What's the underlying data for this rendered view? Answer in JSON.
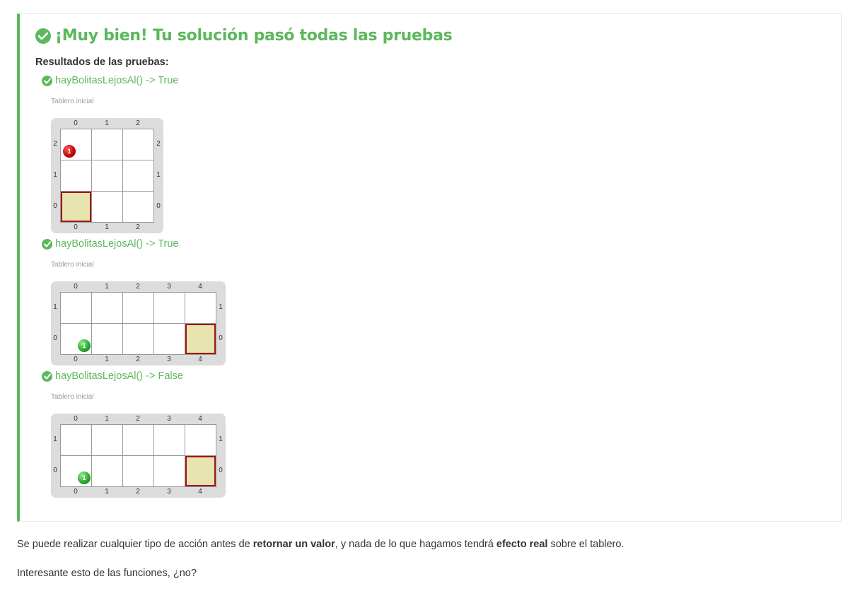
{
  "result": {
    "title": "¡Muy bien! Tu solución pasó todas las pruebas",
    "results_heading": "Resultados de las pruebas:"
  },
  "tests": [
    {
      "label": "hayBolitasLejosAl() -> True",
      "caption": "Tablero inicial",
      "cols": [
        "0",
        "1",
        "2"
      ],
      "rows": [
        "2",
        "1",
        "0"
      ],
      "bolita": {
        "color": "red",
        "count": "1",
        "col": 0,
        "row": 2
      },
      "head": {
        "col": 0,
        "row": 0
      }
    },
    {
      "label": "hayBolitasLejosAl() -> True",
      "caption": "Tablero inicial",
      "cols": [
        "0",
        "1",
        "2",
        "3",
        "4"
      ],
      "rows": [
        "1",
        "0"
      ],
      "bolita": {
        "color": "green",
        "count": "1",
        "col": 0,
        "row": 0
      },
      "head": {
        "col": 4,
        "row": 0
      }
    },
    {
      "label": "hayBolitasLejosAl() -> False",
      "caption": "Tablero inicial",
      "cols": [
        "0",
        "1",
        "2",
        "3",
        "4"
      ],
      "rows": [
        "1",
        "0"
      ],
      "bolita": {
        "color": "green",
        "count": "1",
        "col": 0,
        "row": 0
      },
      "head": {
        "col": 4,
        "row": 0
      }
    }
  ],
  "paragraph1": {
    "part1": "Se puede realizar cualquier tipo de acción antes de ",
    "bold1": "retornar un valor",
    "part2": ", y nada de lo que hagamos tendrá ",
    "bold2": "efecto real",
    "part3": " sobre el tablero."
  },
  "paragraph2": "Interesante esto de las funciones, ¿no?",
  "colors": {
    "success": "#5cb85c",
    "head_border": "#a31515",
    "head_fill": "#e8e4b0"
  }
}
